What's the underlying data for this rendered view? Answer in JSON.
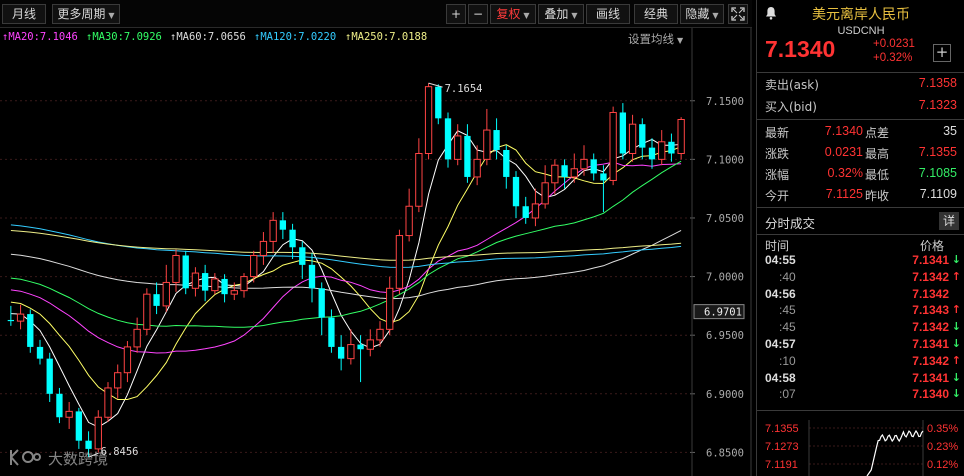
{
  "toolbar": {
    "period_month": "月线",
    "more_periods": "更多周期",
    "zoom_in": "+",
    "zoom_out": "−",
    "adjust": "复权",
    "overlay": "叠加",
    "draw_line": "画线",
    "classic": "经典",
    "hide": "隐藏"
  },
  "ma_legend": [
    {
      "label": "MA20:7.1046",
      "color": "#ff44ff"
    },
    {
      "label": "MA30:7.0926",
      "color": "#33ff66"
    },
    {
      "label": "MA60:7.0656",
      "color": "#dddddd"
    },
    {
      "label": "MA120:7.0220",
      "color": "#33ccff"
    },
    {
      "label": "MA250:7.0188",
      "color": "#eeee88"
    }
  ],
  "ma_settings": "设置均线",
  "chart_data": {
    "type": "candlestick",
    "y_ticks": [
      "7.1500",
      "7.1000",
      "7.0500",
      "7.0000",
      "6.9500",
      "6.9000",
      "6.8500"
    ],
    "ylim": [
      6.835,
      7.195
    ],
    "high_label": "7.1654",
    "low_label": "6.8456",
    "current_price_tag": "6.9701",
    "up_color": "#ff4444",
    "down_color": "#00ffff",
    "candles": [
      [
        6.963,
        6.962,
        6.975,
        6.958
      ],
      [
        6.962,
        6.968,
        6.976,
        6.955
      ],
      [
        6.968,
        6.94,
        6.972,
        6.935
      ],
      [
        6.94,
        6.93,
        6.946,
        6.925
      ],
      [
        6.93,
        6.9,
        6.935,
        6.893
      ],
      [
        6.9,
        6.88,
        6.905,
        6.875
      ],
      [
        6.88,
        6.885,
        6.893,
        6.87
      ],
      [
        6.885,
        6.86,
        6.888,
        6.853
      ],
      [
        6.86,
        6.853,
        6.868,
        6.846
      ],
      [
        6.853,
        6.88,
        6.886,
        6.85
      ],
      [
        6.88,
        6.905,
        6.91,
        6.876
      ],
      [
        6.905,
        6.918,
        6.925,
        6.896
      ],
      [
        6.918,
        6.94,
        6.945,
        6.91
      ],
      [
        6.94,
        6.955,
        6.965,
        6.935
      ],
      [
        6.955,
        6.985,
        6.99,
        6.95
      ],
      [
        6.985,
        6.975,
        6.995,
        6.968
      ],
      [
        6.975,
        6.995,
        7.01,
        6.97
      ],
      [
        6.995,
        7.018,
        7.023,
        6.987
      ],
      [
        7.018,
        6.99,
        7.022,
        6.985
      ],
      [
        6.99,
        7.003,
        7.008,
        6.983
      ],
      [
        7.003,
        6.988,
        7.01,
        6.979
      ],
      [
        6.988,
        6.998,
        7.003,
        6.985
      ],
      [
        6.998,
        6.985,
        7.002,
        6.978
      ],
      [
        6.985,
        6.988,
        6.995,
        6.98
      ],
      [
        6.988,
        7.0,
        7.003,
        6.982
      ],
      [
        7.0,
        7.018,
        7.022,
        6.995
      ],
      [
        7.018,
        7.03,
        7.038,
        7.01
      ],
      [
        7.03,
        7.048,
        7.055,
        7.02
      ],
      [
        7.048,
        7.04,
        7.055,
        7.032
      ],
      [
        7.04,
        7.025,
        7.045,
        7.015
      ],
      [
        7.025,
        7.01,
        7.03,
        6.998
      ],
      [
        7.01,
        6.99,
        7.02,
        6.978
      ],
      [
        6.99,
        6.965,
        6.995,
        6.95
      ],
      [
        6.965,
        6.94,
        6.972,
        6.935
      ],
      [
        6.94,
        6.93,
        6.95,
        6.92
      ],
      [
        6.93,
        6.942,
        6.955,
        6.925
      ],
      [
        6.942,
        6.938,
        6.95,
        6.91
      ],
      [
        6.938,
        6.946,
        6.955,
        6.932
      ],
      [
        6.946,
        6.955,
        6.962,
        6.94
      ],
      [
        6.955,
        6.99,
        7.0,
        6.95
      ],
      [
        6.99,
        7.035,
        7.04,
        6.985
      ],
      [
        7.035,
        7.06,
        7.075,
        7.03
      ],
      [
        7.06,
        7.105,
        7.118,
        7.055
      ],
      [
        7.105,
        7.162,
        7.165,
        7.1
      ],
      [
        7.162,
        7.135,
        7.164,
        7.13
      ],
      [
        7.135,
        7.1,
        7.14,
        7.093
      ],
      [
        7.1,
        7.12,
        7.13,
        7.095
      ],
      [
        7.12,
        7.085,
        7.13,
        7.08
      ],
      [
        7.085,
        7.1,
        7.112,
        7.078
      ],
      [
        7.1,
        7.125,
        7.143,
        7.095
      ],
      [
        7.125,
        7.108,
        7.135,
        7.1
      ],
      [
        7.108,
        7.085,
        7.112,
        7.075
      ],
      [
        7.085,
        7.06,
        7.09,
        7.05
      ],
      [
        7.06,
        7.05,
        7.068,
        7.045
      ],
      [
        7.05,
        7.062,
        7.075,
        7.043
      ],
      [
        7.062,
        7.08,
        7.095,
        7.058
      ],
      [
        7.08,
        7.095,
        7.1,
        7.07
      ],
      [
        7.095,
        7.085,
        7.1,
        7.075
      ],
      [
        7.085,
        7.092,
        7.105,
        7.08
      ],
      [
        7.092,
        7.1,
        7.112,
        7.086
      ],
      [
        7.1,
        7.088,
        7.105,
        7.082
      ],
      [
        7.088,
        7.082,
        7.095,
        7.055
      ],
      [
        7.082,
        7.14,
        7.145,
        7.078
      ],
      [
        7.14,
        7.105,
        7.148,
        7.1
      ],
      [
        7.105,
        7.13,
        7.138,
        7.098
      ],
      [
        7.13,
        7.11,
        7.135,
        7.1
      ],
      [
        7.11,
        7.1,
        7.118,
        7.092
      ],
      [
        7.1,
        7.115,
        7.125,
        7.095
      ],
      [
        7.115,
        7.105,
        7.122,
        7.098
      ],
      [
        7.105,
        7.134,
        7.136,
        7.1
      ]
    ]
  },
  "panel": {
    "title": "美元离岸人民币",
    "code": "USDCNH",
    "price": "7.1340",
    "change": "+0.0231",
    "change_pct": "+0.32%",
    "add_btn": "+",
    "ask_label": "卖出(ask)",
    "ask_value": "7.1358",
    "bid_label": "买入(bid)",
    "bid_value": "7.1323",
    "latest_label": "最新",
    "latest_value": "7.1340",
    "spread_label": "点差",
    "spread_value": "35",
    "chg_label": "涨跌",
    "chg_value": "0.0231",
    "high_label": "最高",
    "high_value": "7.1355",
    "pct_label": "涨幅",
    "pct_value": "0.32%",
    "low_label": "最低",
    "low_value": "7.1085",
    "open_label": "今开",
    "open_value": "7.1125",
    "prev_label": "昨收",
    "prev_value": "7.1109",
    "trades_title": "分时成交",
    "trades_more": "详",
    "col_time": "时间",
    "col_price": "价格",
    "trades": [
      {
        "time": "04:55",
        "price": "7.1341",
        "dir": "down"
      },
      {
        "time": ":40",
        "price": "7.1342",
        "dir": "up"
      },
      {
        "time": "04:56",
        "price": "7.1342",
        "dir": "none"
      },
      {
        "time": ":45",
        "price": "7.1343",
        "dir": "up"
      },
      {
        "time": ":45",
        "price": "7.1342",
        "dir": "down"
      },
      {
        "time": "04:57",
        "price": "7.1341",
        "dir": "down"
      },
      {
        "time": ":10",
        "price": "7.1342",
        "dir": "up"
      },
      {
        "time": "04:58",
        "price": "7.1341",
        "dir": "down"
      },
      {
        "time": ":07",
        "price": "7.1340",
        "dir": "down"
      }
    ],
    "mini_prices": [
      "7.1355",
      "7.1273",
      "7.1191"
    ],
    "mini_pcts": [
      "0.35%",
      "0.23%",
      "0.12%"
    ]
  },
  "watermark": "大数跨境"
}
